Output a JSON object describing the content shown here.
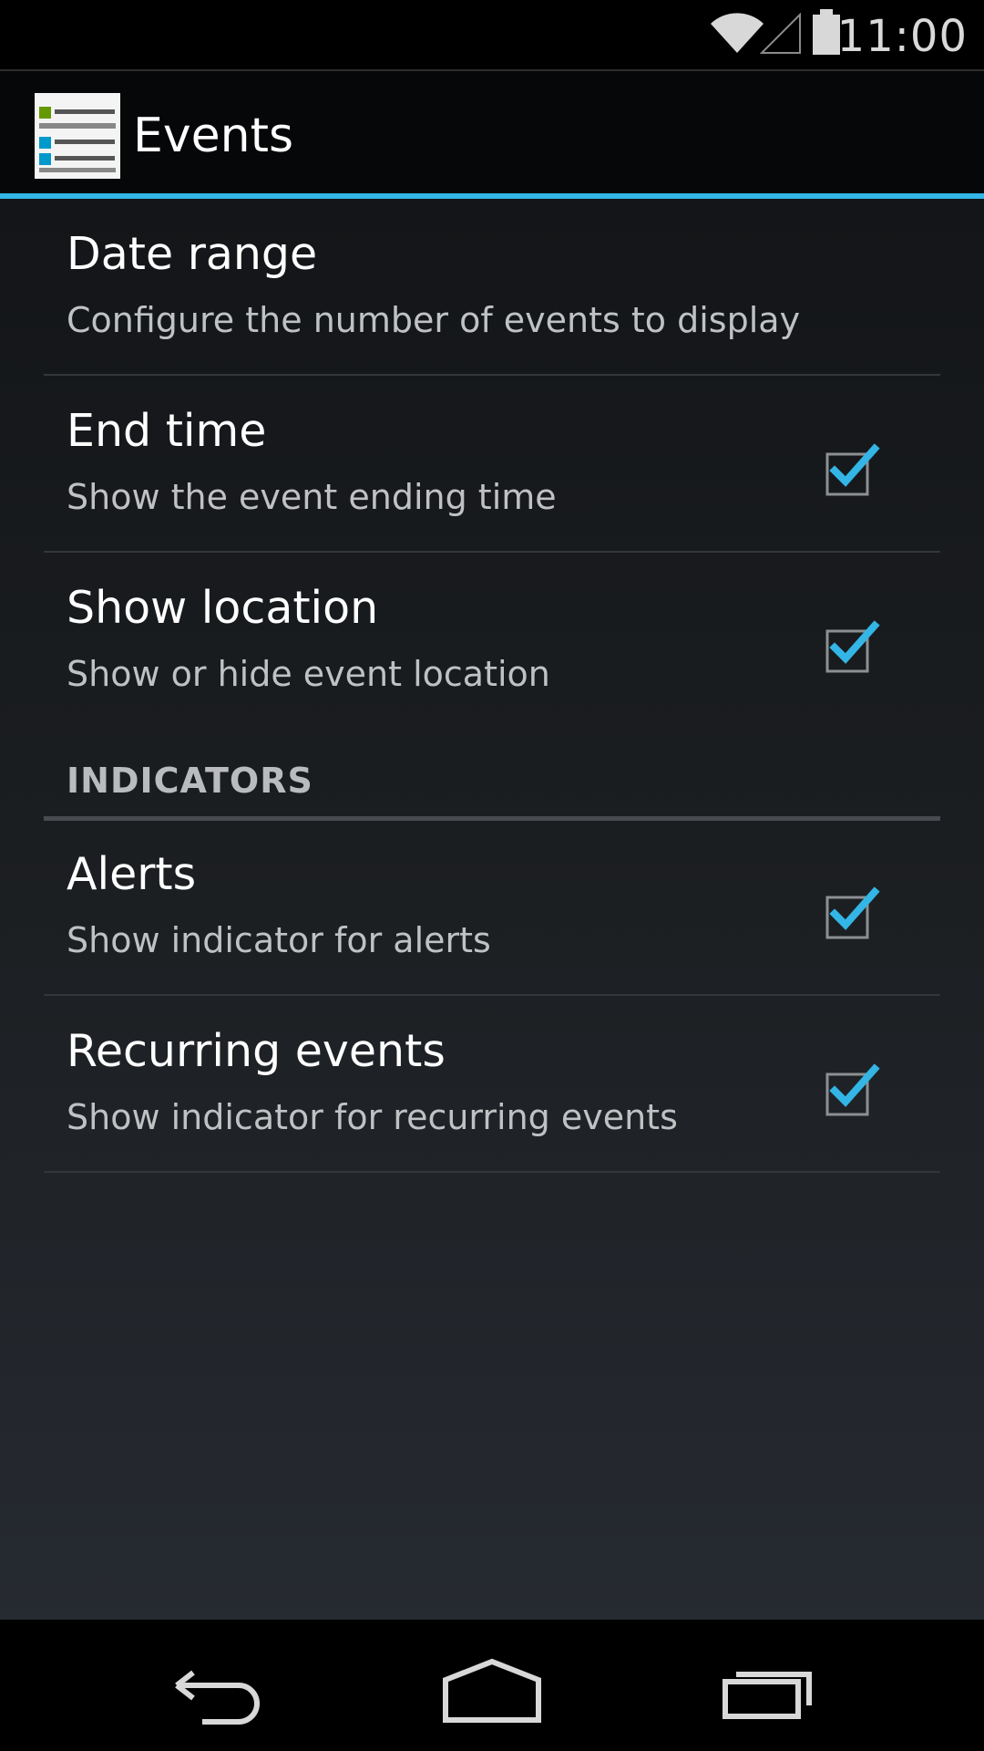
{
  "status_bar": {
    "time": "11:00",
    "icons": [
      "wifi-icon",
      "cell-signal-icon",
      "battery-icon"
    ]
  },
  "action_bar": {
    "title": "Events",
    "app_icon": "events-list-icon"
  },
  "preferences": [
    {
      "title": "Date range",
      "summary": "Configure the number of events to display",
      "has_checkbox": false
    },
    {
      "title": "End time",
      "summary": "Show the event ending time",
      "has_checkbox": true,
      "checked": true
    },
    {
      "title": "Show location",
      "summary": "Show or hide event location",
      "has_checkbox": true,
      "checked": true
    }
  ],
  "indicators": {
    "header": "INDICATORS",
    "items": [
      {
        "title": "Alerts",
        "summary": "Show indicator for alerts",
        "has_checkbox": true,
        "checked": true
      },
      {
        "title": "Recurring events",
        "summary": "Show indicator for recurring events",
        "has_checkbox": true,
        "checked": true
      }
    ]
  },
  "nav_bar": {
    "buttons": [
      "back-icon",
      "home-icon",
      "recents-icon"
    ]
  },
  "colors": {
    "accent": "#33b5e5",
    "check": "#33b5e5",
    "background_dark": "#000000",
    "text_primary": "#ffffff",
    "text_secondary": "#bfc1c3"
  }
}
